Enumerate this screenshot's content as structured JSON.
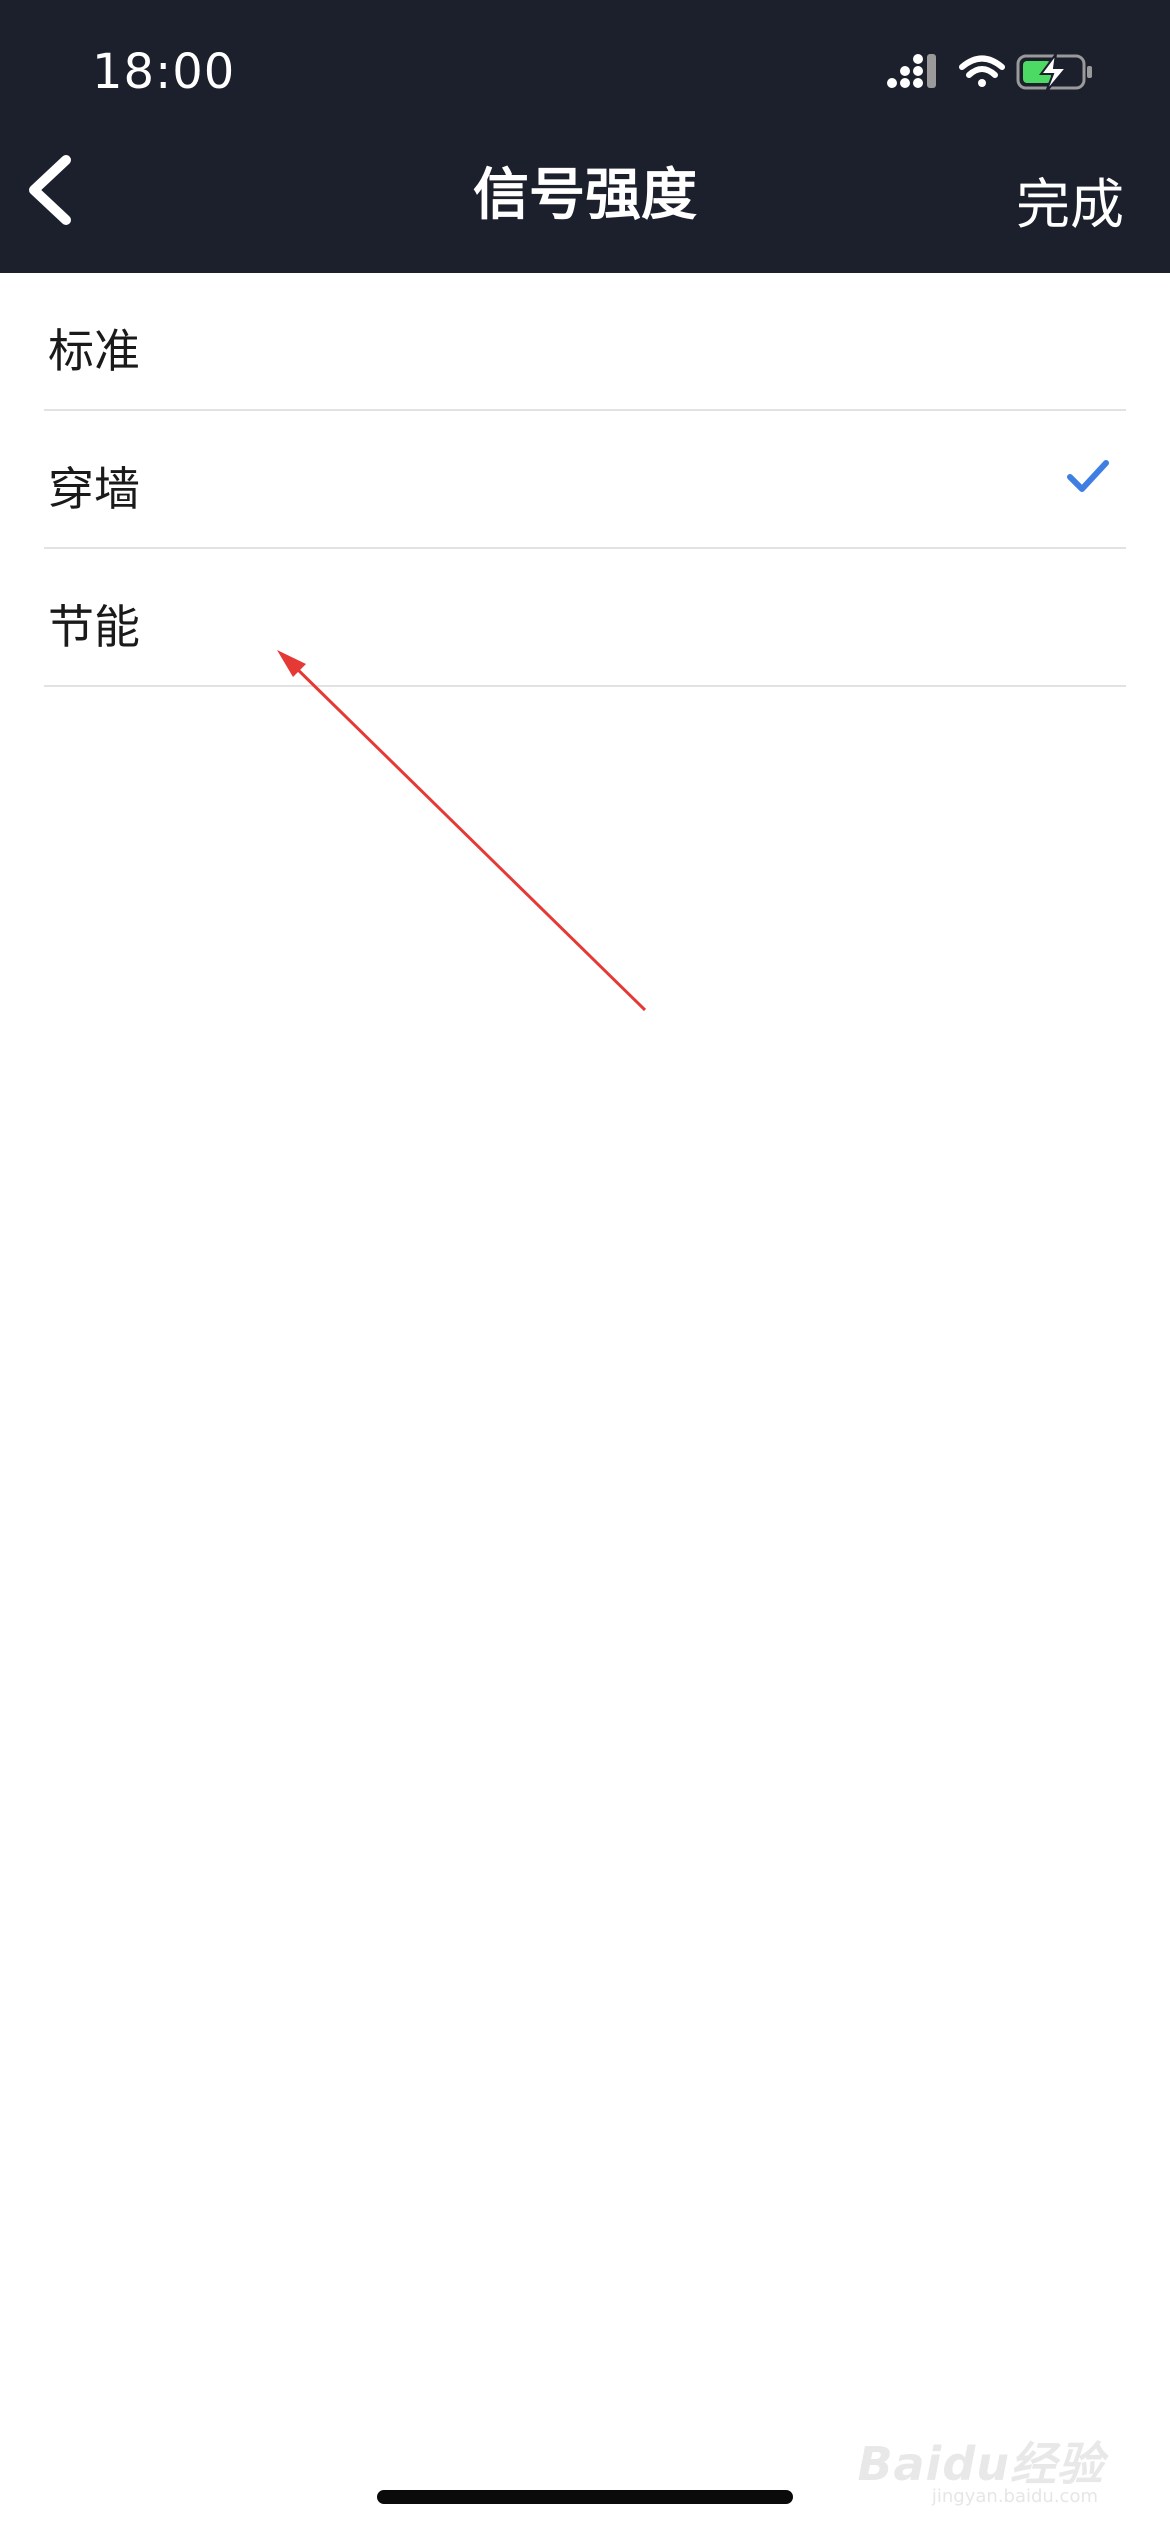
{
  "status_bar": {
    "time": "18:00"
  },
  "nav": {
    "title": "信号强度",
    "done_label": "完成"
  },
  "options": [
    {
      "label": "标准",
      "selected": false
    },
    {
      "label": "穿墙",
      "selected": true
    },
    {
      "label": "节能",
      "selected": false
    }
  ],
  "colors": {
    "header_bg": "#1c1f2c",
    "check": "#3f7ee3",
    "battery": "#4cd964",
    "annotation_arrow": "#e53935"
  },
  "icons": {
    "back": "chevron-left-icon",
    "signal": "cellular-signal-icon",
    "wifi": "wifi-icon",
    "battery": "battery-charging-icon",
    "check": "checkmark-icon"
  },
  "watermark": {
    "brand": "Baidu经验",
    "url": "jingyan.baidu.com"
  }
}
